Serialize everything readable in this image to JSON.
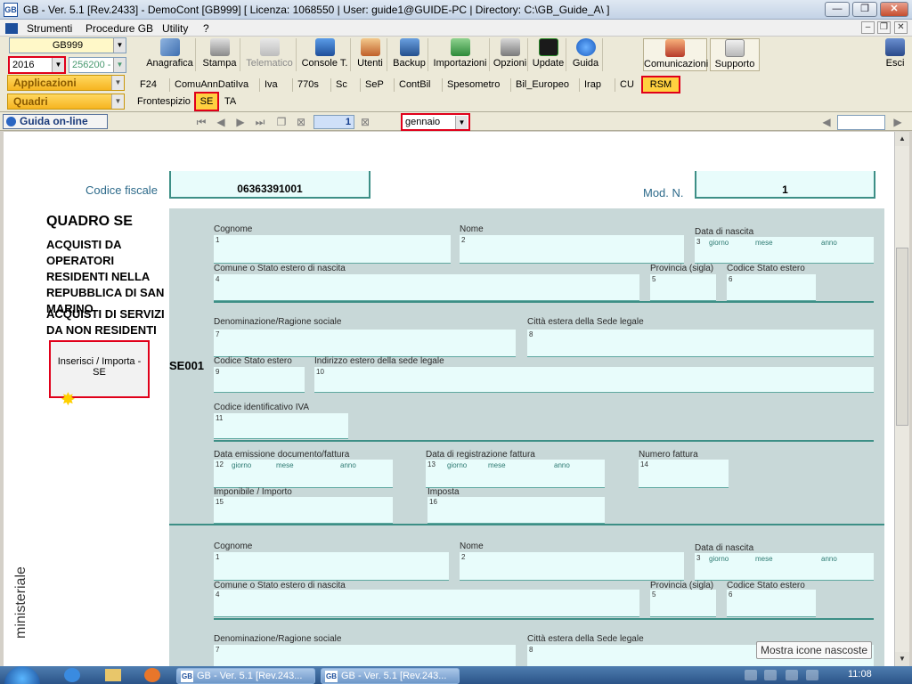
{
  "window": {
    "title": "GB - Ver. 5.1 [Rev.2433] - DemoCont [GB999]    [ Licenza: 1068550 | User: guide1@GUIDE-PC | Directory: C:\\GB_Guide_A\\ ]",
    "app_icon": "GB",
    "min_label": "—",
    "max_label": "❐",
    "close_label": "✕"
  },
  "menu": {
    "items": [
      "Strumenti",
      "Procedure GB",
      "Utility",
      "?"
    ],
    "mdi_min": "–",
    "mdi_restore": "❐",
    "mdi_close": "✕"
  },
  "selectors": {
    "company": "GB999",
    "year": "2016",
    "code": "256200 -",
    "applicazioni": "Applicazioni",
    "quadri": "Quadri"
  },
  "toolbar": {
    "buttons": [
      {
        "label": "Anagrafica",
        "icon": "address-book-icon"
      },
      {
        "label": "Stampa",
        "icon": "printer-icon"
      },
      {
        "label": "Telematico",
        "icon": "telematico-icon"
      },
      {
        "label": "Console T.",
        "icon": "console-icon"
      },
      {
        "label": "Utenti",
        "icon": "users-icon"
      },
      {
        "label": "Backup",
        "icon": "backup-icon"
      },
      {
        "label": "Importazioni",
        "icon": "import-icon"
      },
      {
        "label": "Opzioni",
        "icon": "options-icon"
      },
      {
        "label": "Update",
        "icon": "update-icon"
      },
      {
        "label": "Guida",
        "icon": "help-icon"
      },
      {
        "label": "Comunicazioni",
        "icon": "communications-icon"
      },
      {
        "label": "Supporto",
        "icon": "support-icon"
      },
      {
        "label": "Esci",
        "icon": "exit-icon"
      }
    ]
  },
  "app_tabs": [
    "F24",
    "ComuAnnDatiIva",
    "Iva",
    "770s",
    "Sc",
    "SeP",
    "ContBil",
    "Spesometro",
    "Bil_Europeo",
    "Irap",
    "CU",
    "RSM"
  ],
  "quadri_tabs": [
    "Frontespizio",
    "SE",
    "TA"
  ],
  "nav": {
    "guida_label": "Guida on-line",
    "page": "1",
    "month": "gennaio"
  },
  "form": {
    "codice_fiscale_label": "Codice fiscale",
    "codice_fiscale": "06363391001",
    "mod_label": "Mod. N.",
    "mod_value": "1",
    "quadro_title": "QUADRO SE",
    "quadro_desc1": "ACQUISTI DA OPERATORI RESIDENTI NELLA REPUBBLICA DI SAN MARINO",
    "quadro_desc2": "ACQUISTI DI SERVIZI DA NON RESIDENTI",
    "import_button": "Inserisci / Importa - SE",
    "row_code": "SE001",
    "side_text": "ministeriale",
    "labels": {
      "cognome": "Cognome",
      "nome": "Nome",
      "data_nascita": "Data di nascita",
      "comune": "Comune o Stato estero di nascita",
      "provincia": "Provincia (sigla)",
      "codice_stato": "Codice Stato estero",
      "denominazione": "Denominazione/Ragione sociale",
      "citta_estera": "Città estera della Sede legale",
      "codice_stato2": "Codice Stato estero",
      "indirizzo": "Indirizzo estero della sede legale",
      "codice_iva": "Codice identificativo IVA",
      "data_emissione": "Data emissione documento/fattura",
      "data_registrazione": "Data di registrazione fattura",
      "numero_fattura": "Numero fattura",
      "imponibile": "Imponibile / Importo",
      "imposta": "Imposta",
      "giorno": "giorno",
      "mese": "mese",
      "anno": "anno"
    }
  },
  "tooltip": "Mostra icone nascoste",
  "taskbar": {
    "items": [
      "GB - Ver. 5.1 [Rev.243...",
      "GB - Ver. 5.1 [Rev.243..."
    ],
    "clock": "11:08"
  }
}
